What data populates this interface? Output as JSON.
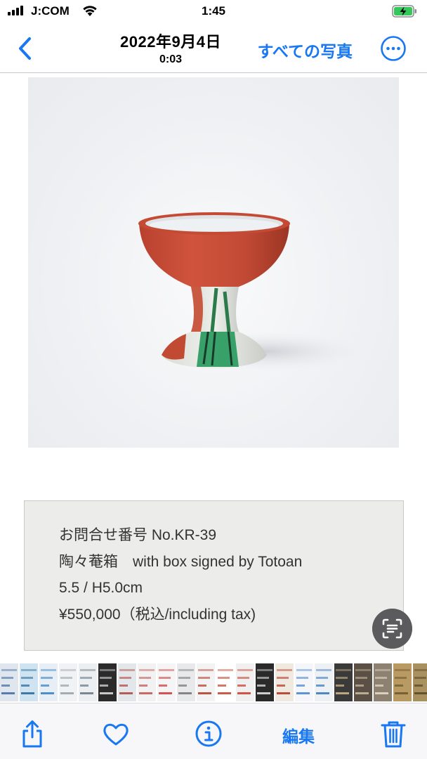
{
  "status_bar": {
    "carrier": "J:COM",
    "time": "1:45"
  },
  "nav": {
    "date": "2022年9月4日",
    "time": "0:03",
    "all_photos_label": "すべての写真"
  },
  "photo": {
    "subject": "red and white stem cup with green pattern"
  },
  "info": {
    "line1": "お問合せ番号 No.KR-39",
    "line2": "陶々菴箱　with box signed by Totoan",
    "line3": "5.5 / H5.0cm",
    "line4": "¥550,000（税込/including tax)"
  },
  "toolbar": {
    "edit_label": "編集"
  },
  "colors": {
    "accent": "#1877f2",
    "panel": "#ececea"
  },
  "thumbnails": [
    {
      "bg": "#dfe6ee",
      "accent": "#4a6fa5"
    },
    {
      "bg": "#cfe3f0",
      "accent": "#2c6e9e"
    },
    {
      "bg": "#e7eef5",
      "accent": "#3a84c8"
    },
    {
      "bg": "#f1f2f4",
      "accent": "#9aa4ad"
    },
    {
      "bg": "#eceff2",
      "accent": "#6d7b88"
    },
    {
      "bg": "#2b2b2b",
      "accent": "#d9d9d9"
    },
    {
      "bg": "#e4e7ea",
      "accent": "#b04a4a"
    },
    {
      "bg": "#f2f2f2",
      "accent": "#c05a5a"
    },
    {
      "bg": "#f5f5f5",
      "accent": "#d04040"
    },
    {
      "bg": "#e8e9ea",
      "accent": "#7a7a7a"
    },
    {
      "bg": "#f3f3f3",
      "accent": "#b5412e"
    },
    {
      "bg": "#ffffff",
      "accent": "#c44b33"
    },
    {
      "bg": "#f0f0f0",
      "accent": "#cc4433"
    },
    {
      "bg": "#2a2a2a",
      "accent": "#e0e0e0"
    },
    {
      "bg": "#efe9e0",
      "accent": "#b53b2a"
    },
    {
      "bg": "#f4f6f9",
      "accent": "#4d8ad0"
    },
    {
      "bg": "#eef1f4",
      "accent": "#3b7bbf"
    },
    {
      "bg": "#3a3a3a",
      "accent": "#c9b48a"
    },
    {
      "bg": "#5a5046",
      "accent": "#c8b59a"
    },
    {
      "bg": "#8d8272",
      "accent": "#e3d8c4"
    },
    {
      "bg": "#b99a63",
      "accent": "#6e5a33"
    },
    {
      "bg": "#a8905f",
      "accent": "#5a4a2a"
    },
    {
      "bg": "#dfe8da",
      "accent": "#6aa05a"
    }
  ]
}
